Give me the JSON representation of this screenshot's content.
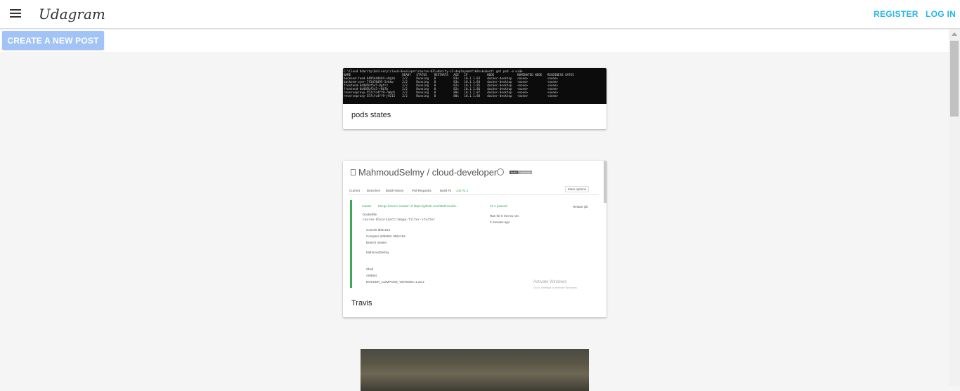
{
  "app": {
    "brand": "Udagram"
  },
  "nav": {
    "register": "REGISTER",
    "login": "LOG IN"
  },
  "actions": {
    "create_post": "CREATE A NEW POST"
  },
  "posts": [
    {
      "caption": "pods states",
      "terminal_lines": [
        "C:\\Cloud Udacity\\Delivery\\cloud-developer\\course-03\\udacity-c3-deployment\\k8s>kubectl get pod -o wide",
        "NAME                             READY   STATUS    RESTARTS   AGE   IP           NODE             NOMINATED NODE   READINESS GATES",
        "backend-feed-649544d694-x9gzb    2/2     Running   0          83s   10.1.1.83    docker-desktop   <none>           <none>",
        "backend-user-7f5d78d95-5vhkw     2/2     Running   0          83s   10.1.1.84    docker-desktop   <none>           <none>",
        "frontend-6d485bf5c5-8gfrz        2/2     Running   0          82s   10.1.1.85    docker-desktop   <none>           <none>",
        "frontend-6d485bf5c5-r8b7b        2/2     Running   0          82s   10.1.1.86    docker-desktop   <none>           <none>",
        "reverseproxy-557cfc4ff9-7mmp5    2/2     Running   0          80s   10.1.1.87    docker-desktop   <none>           <none>",
        "reverseproxy-557cfc4ff9-j9215    2/2     Running   0          80s   10.1.1.88    docker-desktop   <none>           <none>"
      ]
    },
    {
      "caption": "Travis",
      "travis": {
        "repo_title": "MahmoudSelmy / cloud-developer",
        "badge_left": "build",
        "badge_right": "unknown",
        "tabs": [
          "Current",
          "Branches",
          "Build History",
          "Pull Requests",
          "Build #2",
          "Job #2.1"
        ],
        "more_options": "More options",
        "commit_branch": "master",
        "commit_msg": "Merge branch 'master' of https://github.com/MahmoudS...",
        "job_status": "#2.1 passed",
        "ran_for": "Ran for 6 min 51 sec",
        "ago": "3 minutes ago",
        "restart": "Restart job",
        "dockerfile": "Dockerfile",
        "path": "course-03/project/image-filter-starter",
        "commit": "Commit 6bbc194",
        "compare": "Compare a0fe993..6bbc194",
        "branch": "Branch master",
        "author": "MahmoudSelmy",
        "shell": "Shell",
        "arch": "AMD64",
        "env": "DOCKER_COMPOSE_VERSION=1.23.2",
        "watermark": "Activate Windows",
        "watermark_sub": "Go to Settings to activate Windows."
      }
    },
    {
      "caption": ""
    }
  ],
  "colors": {
    "accent": "#25b6e0",
    "button": "#a2c3f5",
    "travis_green": "#39aa56"
  }
}
